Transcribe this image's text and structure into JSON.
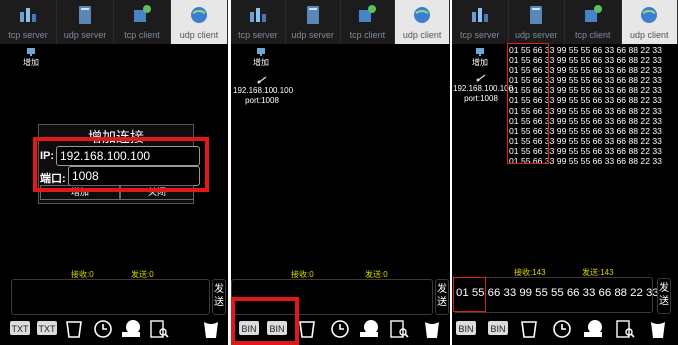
{
  "tabs": [
    "tcp server",
    "udp server",
    "tcp client",
    "udp client"
  ],
  "panel1": {
    "add_label": "增加",
    "dialog": {
      "title": "增加连接",
      "ip_label": "IP:",
      "ip_value": "192.168.100.100",
      "port_label": "端口:",
      "port_value": "1008",
      "add_button": "增加",
      "close_button": "关闭"
    },
    "recv": "接收:0",
    "sent": "发送:0",
    "send_button": "发送"
  },
  "panel2": {
    "add_label": "增加",
    "connection": {
      "ip": "192.168.100.100",
      "port": "port:1008"
    },
    "recv": "接收:0",
    "sent": "发送:0",
    "send_button": "发送"
  },
  "panel3": {
    "add_label": "增加",
    "connection": {
      "ip": "192.168.100.100",
      "port": "port:1008"
    },
    "log_lines": [
      "01 55 66 33 99 55 55 66 33 66 88 22 33",
      "01 55 66 33 99 55 55 66 33 66 88 22 33",
      "01 55 66 33 99 55 55 66 33 66 88 22 33",
      "01 55 66 33 99 55 55 66 33 66 88 22 33",
      "01 55 66 33 99 55 55 66 33 66 88 22 33",
      "01 55 66 33 99 55 55 66 33 66 88 22 33",
      "01 55 66 33 99 55 55 66 33 66 88 22 33",
      "01 55 66 33 99 55 55 66 33 66 88 22 33",
      "01 55 66 33 99 55 55 66 33 66 88 22 33",
      "01 55 66 33 99 55 55 66 33 66 88 22 33",
      "01 55 66 33 99 55 55 66 33 66 88 22 33",
      "01 55 66 33 99 55 55 66 33 66 88 22 33"
    ],
    "recv": "接收:143",
    "sent": "发送:143",
    "send_input": "01 55 66 33 99 55 55 66 33 66 88 22 33",
    "send_button": "发送"
  },
  "toolbar": {
    "txt_label": "TXT",
    "bin_label": "BIN"
  },
  "colors": {
    "accent_red": "#e01818",
    "status_yellow": "#d9d900",
    "tab_active_bg": "#e7e7e7"
  },
  "icons": [
    "network-icon",
    "server-icon",
    "client-icon",
    "globe-icon",
    "cup-icon",
    "clock-icon",
    "computer-icon",
    "document-search-icon",
    "trash-icon"
  ]
}
